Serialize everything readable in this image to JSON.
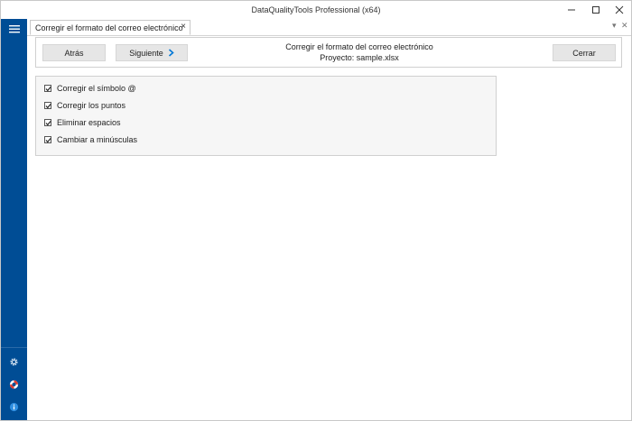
{
  "window": {
    "title": "DataQualityTools Professional (x64)"
  },
  "tabs": [
    {
      "label": "Corregir el formato del correo electrónico",
      "active": true
    }
  ],
  "toolbar": {
    "back_label": "Atrás",
    "next_label": "Siguiente",
    "heading": "Corregir el formato del correo electrónico",
    "project": "Proyecto: sample.xlsx",
    "close_label": "Cerrar"
  },
  "options": [
    {
      "label": "Corregir el símbolo @",
      "checked": true
    },
    {
      "label": "Corregir los puntos",
      "checked": true
    },
    {
      "label": "Eliminar espacios",
      "checked": true
    },
    {
      "label": "Cambiar a minúsculas",
      "checked": true
    }
  ],
  "sidebar": {
    "icons": [
      "menu-icon",
      "gear-icon",
      "lifebuoy-icon",
      "info-icon"
    ]
  },
  "colors": {
    "sidebar": "#004d95",
    "accent": "#0078d7",
    "button_bg": "#e6e6e6"
  }
}
